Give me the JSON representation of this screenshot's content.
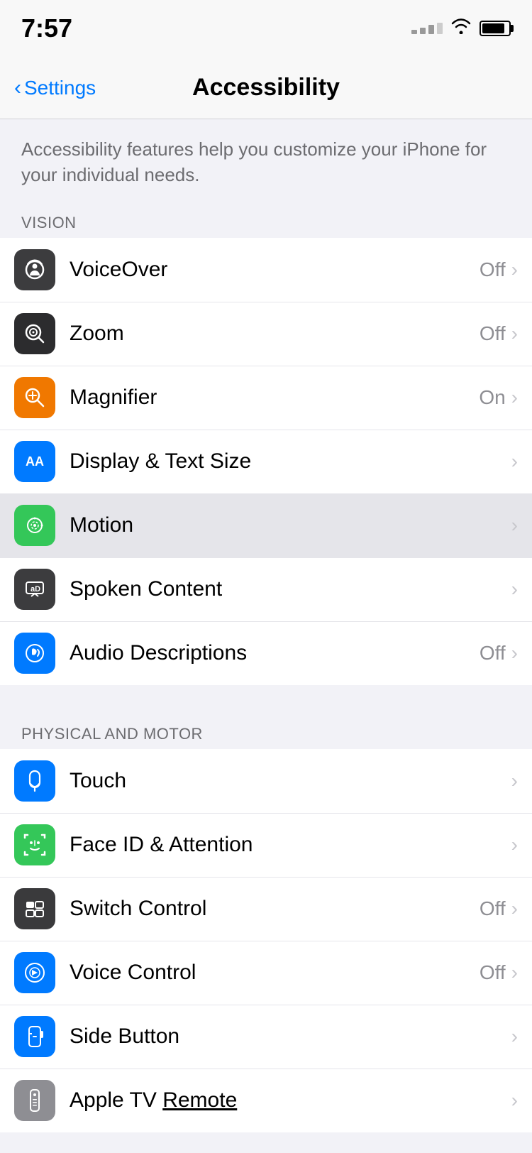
{
  "status": {
    "time": "7:57",
    "battery_level": 85
  },
  "nav": {
    "back_label": "Settings",
    "title": "Accessibility"
  },
  "description": {
    "text": "Accessibility features help you customize your iPhone for your individual needs."
  },
  "vision_section": {
    "header": "VISION",
    "items": [
      {
        "id": "voiceover",
        "label": "VoiceOver",
        "value": "Off",
        "icon_color": "dark-gray"
      },
      {
        "id": "zoom",
        "label": "Zoom",
        "value": "Off",
        "icon_color": "black"
      },
      {
        "id": "magnifier",
        "label": "Magnifier",
        "value": "On",
        "icon_color": "orange"
      },
      {
        "id": "display-text",
        "label": "Display & Text Size",
        "value": "",
        "icon_color": "blue"
      },
      {
        "id": "motion",
        "label": "Motion",
        "value": "",
        "icon_color": "green",
        "highlighted": true
      },
      {
        "id": "spoken-content",
        "label": "Spoken Content",
        "value": "",
        "icon_color": "dark-gray-2"
      },
      {
        "id": "audio-descriptions",
        "label": "Audio Descriptions",
        "value": "Off",
        "icon_color": "blue2"
      }
    ]
  },
  "physical_section": {
    "header": "PHYSICAL AND MOTOR",
    "items": [
      {
        "id": "touch",
        "label": "Touch",
        "value": "",
        "icon_color": "blue"
      },
      {
        "id": "face-id",
        "label": "Face ID & Attention",
        "value": "",
        "icon_color": "green"
      },
      {
        "id": "switch-control",
        "label": "Switch Control",
        "value": "Off",
        "icon_color": "dark-grid"
      },
      {
        "id": "voice-control",
        "label": "Voice Control",
        "value": "Off",
        "icon_color": "blue3"
      },
      {
        "id": "side-button",
        "label": "Side Button",
        "value": "",
        "icon_color": "blue4"
      },
      {
        "id": "apple-tv-remote",
        "label": "Apple TV Remote",
        "value": "",
        "icon_color": "light-gray",
        "underline": true
      }
    ]
  },
  "chevron": "›",
  "back_arrow": "‹"
}
